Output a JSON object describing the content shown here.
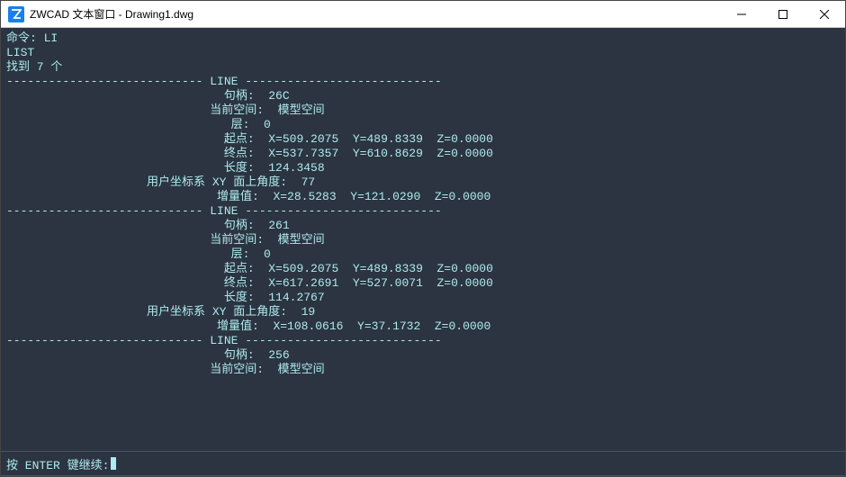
{
  "window": {
    "title": "ZWCAD 文本窗口 - Drawing1.dwg"
  },
  "terminal": {
    "command_prefix": "命令: ",
    "command": "LI",
    "list_header": "LIST",
    "found": "找到 7 个",
    "entities": [
      {
        "type": "LINE",
        "handle_label": "句柄:",
        "handle": "26C",
        "space_label": "当前空间:",
        "space": "模型空间",
        "layer_label": "层:",
        "layer": "0",
        "start_label": "起点:",
        "start": "X=509.2075  Y=489.8339  Z=0.0000",
        "end_label": "终点:",
        "end": "X=537.7357  Y=610.8629  Z=0.0000",
        "length_label": "长度:",
        "length": "124.3458",
        "angle_label": "用户坐标系 XY 面上角度:",
        "angle": "77",
        "delta_label": "增量值:",
        "delta": "X=28.5283  Y=121.0290  Z=0.0000"
      },
      {
        "type": "LINE",
        "handle_label": "句柄:",
        "handle": "261",
        "space_label": "当前空间:",
        "space": "模型空间",
        "layer_label": "层:",
        "layer": "0",
        "start_label": "起点:",
        "start": "X=509.2075  Y=489.8339  Z=0.0000",
        "end_label": "终点:",
        "end": "X=617.2691  Y=527.0071  Z=0.0000",
        "length_label": "长度:",
        "length": "114.2767",
        "angle_label": "用户坐标系 XY 面上角度:",
        "angle": "19",
        "delta_label": "增量值:",
        "delta": "X=108.0616  Y=37.1732  Z=0.0000"
      },
      {
        "type": "LINE",
        "handle_label": "句柄:",
        "handle": "256",
        "space_label": "当前空间:",
        "space": "模型空间"
      }
    ],
    "prompt": "按 ENTER 键继续:"
  },
  "dashes_left": "---------------------------- ",
  "dashes_right": " ----------------------------"
}
